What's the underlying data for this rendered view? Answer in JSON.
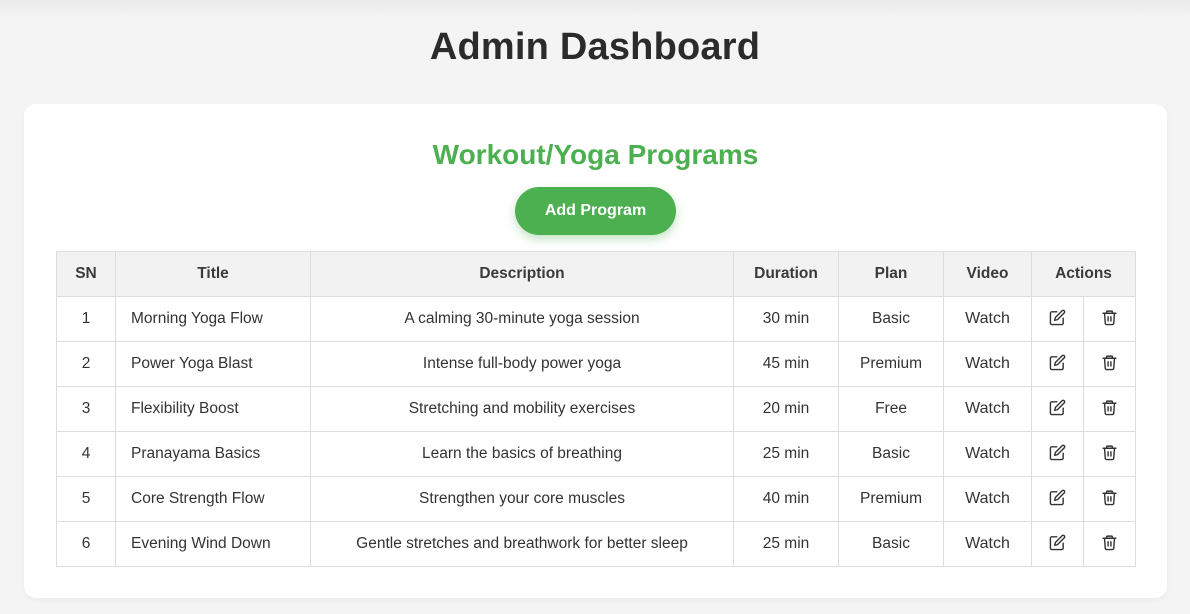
{
  "page": {
    "title": "Admin Dashboard"
  },
  "section": {
    "title": "Workout/Yoga Programs",
    "add_button_label": "Add Program"
  },
  "colors": {
    "accent": "#4caf50",
    "page_bg": "#f4f4f4",
    "header_bg": "#f2f2f2"
  },
  "table": {
    "headers": {
      "sn": "SN",
      "title": "Title",
      "description": "Description",
      "duration": "Duration",
      "plan": "Plan",
      "video": "Video",
      "actions": "Actions"
    },
    "rows": [
      {
        "sn": "1",
        "title": "Morning Yoga Flow",
        "description": "A calming 30-minute yoga session",
        "duration": "30 min",
        "plan": "Basic",
        "video": "Watch",
        "edit_icon": "edit-icon",
        "delete_icon": "trash-icon"
      },
      {
        "sn": "2",
        "title": "Power Yoga Blast",
        "description": "Intense full-body power yoga",
        "duration": "45 min",
        "plan": "Premium",
        "video": "Watch",
        "edit_icon": "edit-icon",
        "delete_icon": "trash-icon"
      },
      {
        "sn": "3",
        "title": "Flexibility Boost",
        "description": "Stretching and mobility exercises",
        "duration": "20 min",
        "plan": "Free",
        "video": "Watch",
        "edit_icon": "edit-icon",
        "delete_icon": "trash-icon"
      },
      {
        "sn": "4",
        "title": "Pranayama Basics",
        "description": "Learn the basics of breathing",
        "duration": "25 min",
        "plan": "Basic",
        "video": "Watch",
        "edit_icon": "edit-icon",
        "delete_icon": "trash-icon"
      },
      {
        "sn": "5",
        "title": "Core Strength Flow",
        "description": "Strengthen your core muscles",
        "duration": "40 min",
        "plan": "Premium",
        "video": "Watch",
        "edit_icon": "edit-icon",
        "delete_icon": "trash-icon"
      },
      {
        "sn": "6",
        "title": "Evening Wind Down",
        "description": "Gentle stretches and breathwork for better sleep",
        "duration": "25 min",
        "plan": "Basic",
        "video": "Watch",
        "edit_icon": "edit-icon",
        "delete_icon": "trash-icon"
      }
    ]
  }
}
